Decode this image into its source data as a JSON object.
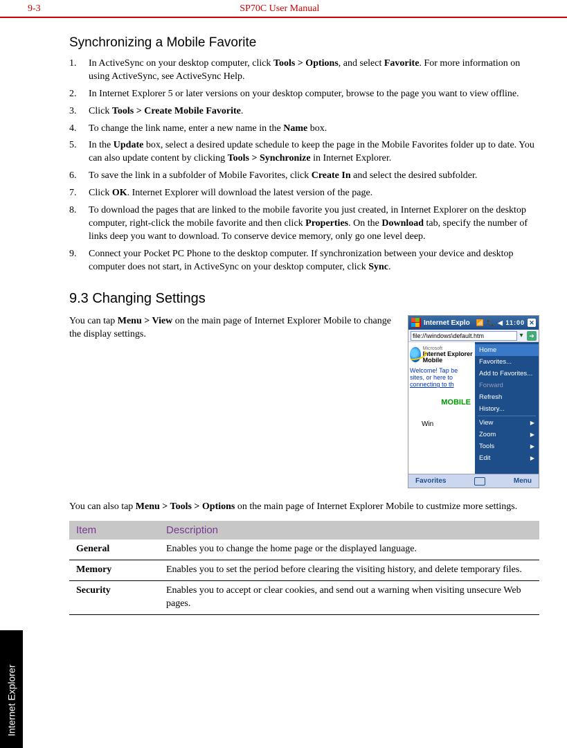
{
  "header": {
    "pageNum": "9-3",
    "title": "SP70C User Manual"
  },
  "sideTab": "Internet Explorer",
  "section1": {
    "title": "Synchronizing a Mobile Favorite",
    "steps": [
      {
        "n": "1.",
        "html": "In ActiveSync on your desktop computer, click <b>Tools > Options</b>, and select <b>Favorite</b>. For more information on using ActiveSync, see ActiveSync Help."
      },
      {
        "n": "2.",
        "html": "In Internet Explorer 5 or later versions on your desktop computer, browse to the page you want to view offline."
      },
      {
        "n": "3.",
        "html": "Click <b>Tools > Create Mobile Favorite</b>."
      },
      {
        "n": "4.",
        "html": "To change the link name, enter a new name in the <b>Name</b> box."
      },
      {
        "n": "5.",
        "html": "In the <b>Update</b> box, select a desired update schedule to keep the page in the Mobile Favorites folder up to date. You can also update content by clicking <b>Tools > Synchronize</b> in Internet Explorer."
      },
      {
        "n": "6.",
        "html": "To save the link in a subfolder of Mobile Favorites, click <b>Create In</b> and select the desired subfolder."
      },
      {
        "n": "7.",
        "html": "Click <b>OK</b>. Internet Explorer will download the latest version of the page."
      },
      {
        "n": "8.",
        "html": "To download the pages that are linked to the mobile favorite you just created, in Internet Explorer on the desktop computer, right-click the mobile favorite and then click <b>Properties</b>. On the <b>Download</b> tab, specify the number of links deep you want to download. To conserve device memory, only go one level deep."
      },
      {
        "n": "9.",
        "html": "Connect your Pocket PC Phone to the desktop computer. If synchronization between your device and desktop computer does not start, in ActiveSync on your desktop computer, click <b>Sync</b>."
      }
    ]
  },
  "section2": {
    "heading": "9.3    Changing Settings",
    "para1_html": "You can tap <b>Menu > View</b> on the main page of Internet Explorer Mobile to change the display settings.",
    "para2_html": "You can also tap <b>Menu > Tools > Options</b> on the main page of Internet Explorer Mobile to custmize more settings.",
    "table": {
      "headers": [
        "Item",
        "Description"
      ],
      "rows": [
        {
          "item": "General",
          "desc": "Enables you to change the home page or the displayed language."
        },
        {
          "item": "Memory",
          "desc": "Enables you to set the period before clearing the visiting history, and delete temporary files."
        },
        {
          "item": "Security",
          "desc": "Enables you to accept or clear cookies, and send out a warning when visiting unsecure Web pages."
        }
      ]
    }
  },
  "screenshot": {
    "title": "Internet Explo",
    "statusIcons": "📶 📞 ◀  11:00",
    "closeX": "✕",
    "url": "file://\\windows\\default.htm",
    "brandMsft": "Microsoft",
    "brandIE": "Internet Explorer Mobile",
    "welcome": {
      "l1": "Welcome! Tap be",
      "l2": "sites, or here to",
      "l3": "connecting to th"
    },
    "mobileWord": "MOBILE",
    "winWord": "Win",
    "menu": [
      {
        "label": "Home",
        "sel": true
      },
      {
        "label": "Favorites..."
      },
      {
        "label": "Add to Favorites..."
      },
      {
        "label": "Forward",
        "disabled": true
      },
      {
        "label": "Refresh"
      },
      {
        "label": "History..."
      },
      {
        "sep": true
      },
      {
        "label": "View",
        "arrow": true
      },
      {
        "label": "Zoom",
        "arrow": true
      },
      {
        "label": "Tools",
        "arrow": true
      },
      {
        "label": "Edit",
        "arrow": true
      }
    ],
    "footer": {
      "left": "Favorites",
      "right": "Menu"
    }
  }
}
